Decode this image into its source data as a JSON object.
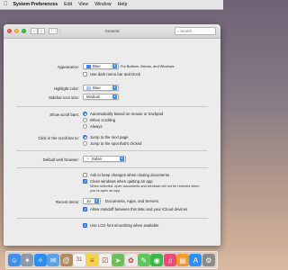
{
  "menubar": {
    "apple_icon": "apple-icon",
    "app_name": "System Preferences",
    "items": [
      "Edit",
      "View",
      "Window",
      "Help"
    ]
  },
  "window": {
    "title": "General",
    "search_placeholder": "Search",
    "back_glyph": "‹",
    "forward_glyph": "›",
    "grid_glyph": "⋮⋮⋮"
  },
  "appearance": {
    "label": "Appearance:",
    "value": "Blue",
    "note": "For Buttons, Menus, and Windows",
    "dark_menu_label": "Use dark menu bar and Dock",
    "dark_menu_checked": false
  },
  "highlight": {
    "label": "Highlight color:",
    "value": "Blue"
  },
  "sidebar": {
    "label": "Sidebar icon size:",
    "value": "Medium"
  },
  "scrollbars": {
    "label": "Show scroll bars:",
    "options": [
      "Automatically based on mouse or trackpad",
      "When scrolling",
      "Always"
    ],
    "selected_index": 0
  },
  "click_scroll": {
    "label": "Click in the scroll bar to:",
    "options": [
      "Jump to the next page",
      "Jump to the spot that's clicked"
    ],
    "selected_index": 0
  },
  "browser": {
    "label": "Default web browser:",
    "value": "Safari"
  },
  "documents": {
    "ask_keep_label": "Ask to keep changes when closing documents",
    "ask_keep_checked": false,
    "close_windows_label": "Close windows when quitting an app",
    "close_windows_checked": true,
    "close_windows_note": "When selected, open documents and windows will not be restored when you re-open an app."
  },
  "recent": {
    "label": "Recent items:",
    "value": "10",
    "suffix": "Documents, Apps, and Servers"
  },
  "handoff": {
    "label": "Allow Handoff between this Mac and your iCloud devices",
    "checked": true
  },
  "lcd": {
    "label": "Use LCD font smoothing when available",
    "checked": true
  },
  "colors": {
    "accent": "#3a87f3",
    "close": "#fc605c",
    "minimize": "#fdbc40",
    "zoom": "#34c84a"
  },
  "dock": {
    "items": [
      {
        "name": "finder-icon",
        "glyph": "☺",
        "color": "#3f8fe6"
      },
      {
        "name": "launchpad-icon",
        "glyph": "✦",
        "color": "#8e9aa8"
      },
      {
        "name": "safari-icon",
        "glyph": "✧",
        "color": "#2d8cf0"
      },
      {
        "name": "mail-icon",
        "glyph": "✉",
        "color": "#5aa3e8"
      },
      {
        "name": "contacts-icon",
        "glyph": "@",
        "color": "#b38a5a"
      },
      {
        "name": "calendar-icon",
        "glyph": "31",
        "color": "#f4f4f4"
      },
      {
        "name": "notes-icon",
        "glyph": "≡",
        "color": "#f3d34a"
      },
      {
        "name": "reminders-icon",
        "glyph": "☑",
        "color": "#f0f0f0"
      },
      {
        "name": "maps-icon",
        "glyph": "➤",
        "color": "#6cbf5a"
      },
      {
        "name": "photos-icon",
        "glyph": "✿",
        "color": "#e8e8e8"
      },
      {
        "name": "messages-icon",
        "glyph": "✎",
        "color": "#5ac85a"
      },
      {
        "name": "facetime-icon",
        "glyph": "◉",
        "color": "#3fb84a"
      },
      {
        "name": "music-icon",
        "glyph": "♫",
        "color": "#e84a7a"
      },
      {
        "name": "books-icon",
        "glyph": "▤",
        "color": "#f29b2c"
      },
      {
        "name": "appstore-icon",
        "glyph": "A",
        "color": "#2f8ef0"
      },
      {
        "name": "system-preferences-icon",
        "glyph": "⚙",
        "color": "#8a8a8a"
      }
    ]
  }
}
